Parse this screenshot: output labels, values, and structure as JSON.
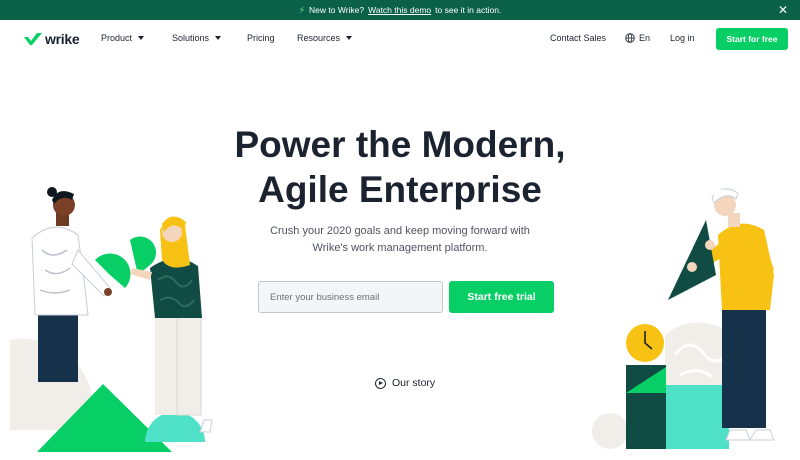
{
  "banner": {
    "prefix": "New to Wrike?",
    "link": "Watch this demo",
    "suffix": "to see it in action."
  },
  "nav": {
    "logo": "wrike",
    "items": [
      {
        "label": "Product",
        "dropdown": true
      },
      {
        "label": "Solutions",
        "dropdown": true
      },
      {
        "label": "Pricing",
        "dropdown": false
      },
      {
        "label": "Resources",
        "dropdown": true
      }
    ],
    "contact": "Contact Sales",
    "language": "En",
    "login": "Log in",
    "cta": "Start for free"
  },
  "hero": {
    "title_line1": "Power the Modern,",
    "title_line2": "Agile Enterprise",
    "subtitle_line1": "Crush your 2020 goals and keep moving forward with",
    "subtitle_line2": "Wrike's work management platform.",
    "email_placeholder": "Enter your business email",
    "trial_button": "Start free trial",
    "story_link": "Our story"
  },
  "colors": {
    "brand_green": "#08cf65",
    "banner_green": "#0b6148",
    "dark_teal": "#104c44",
    "aqua": "#4fe0c8",
    "yellow": "#f7c214",
    "navy": "#16324a"
  }
}
